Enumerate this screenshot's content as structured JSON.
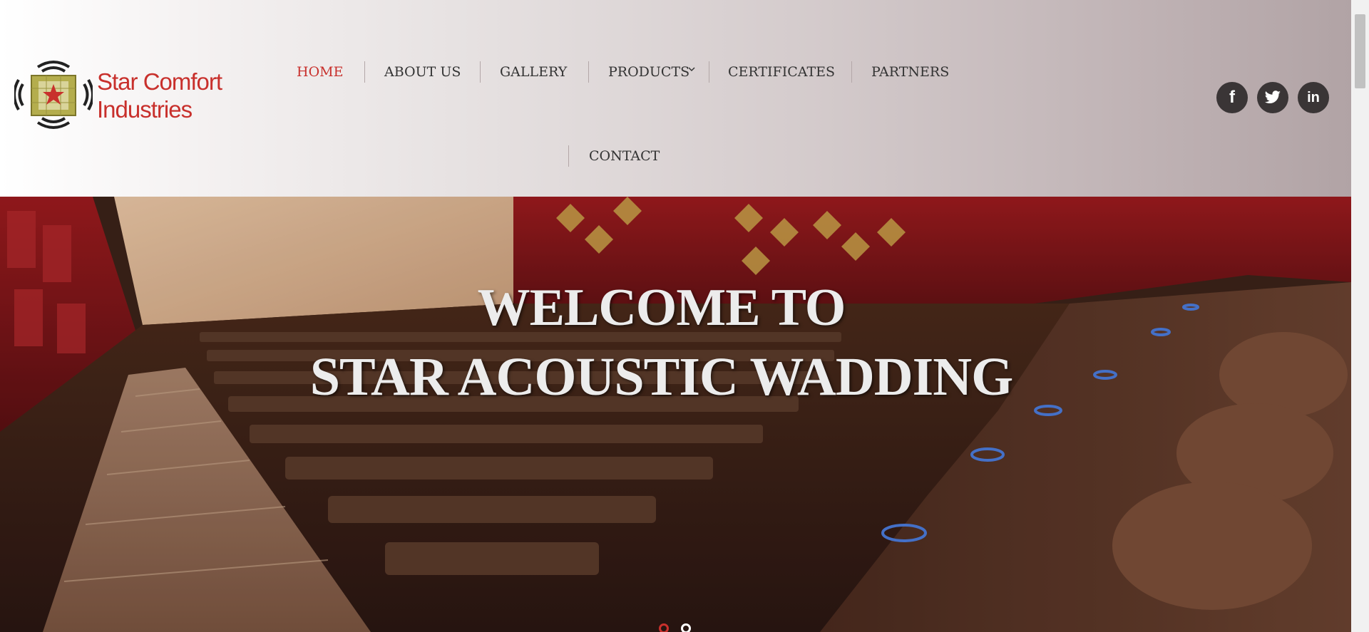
{
  "brand": {
    "line1": "Star Comfort",
    "line2": "Industries",
    "color": "#c8302c"
  },
  "nav": {
    "items": [
      {
        "label": "HOME",
        "active": true
      },
      {
        "label": "ABOUT US",
        "active": false
      },
      {
        "label": "GALLERY",
        "active": false
      },
      {
        "label": "PRODUCTS",
        "active": false,
        "dropdown": true
      },
      {
        "label": "CERTIFICATES",
        "active": false
      },
      {
        "label": "PARTNERS",
        "active": false
      },
      {
        "label": "CONTACT",
        "active": false
      }
    ],
    "active_color": "#c8302c"
  },
  "social": {
    "facebook_glyph": "f",
    "linkedin_glyph": "in",
    "icons": [
      "facebook-icon",
      "twitter-icon",
      "linkedin-icon"
    ]
  },
  "hero": {
    "line1": "WELCOME TO",
    "line2": "STAR ACOUSTIC WADDING",
    "slides": 2,
    "active_slide": 1,
    "active_dot_color": "#c8302c"
  }
}
